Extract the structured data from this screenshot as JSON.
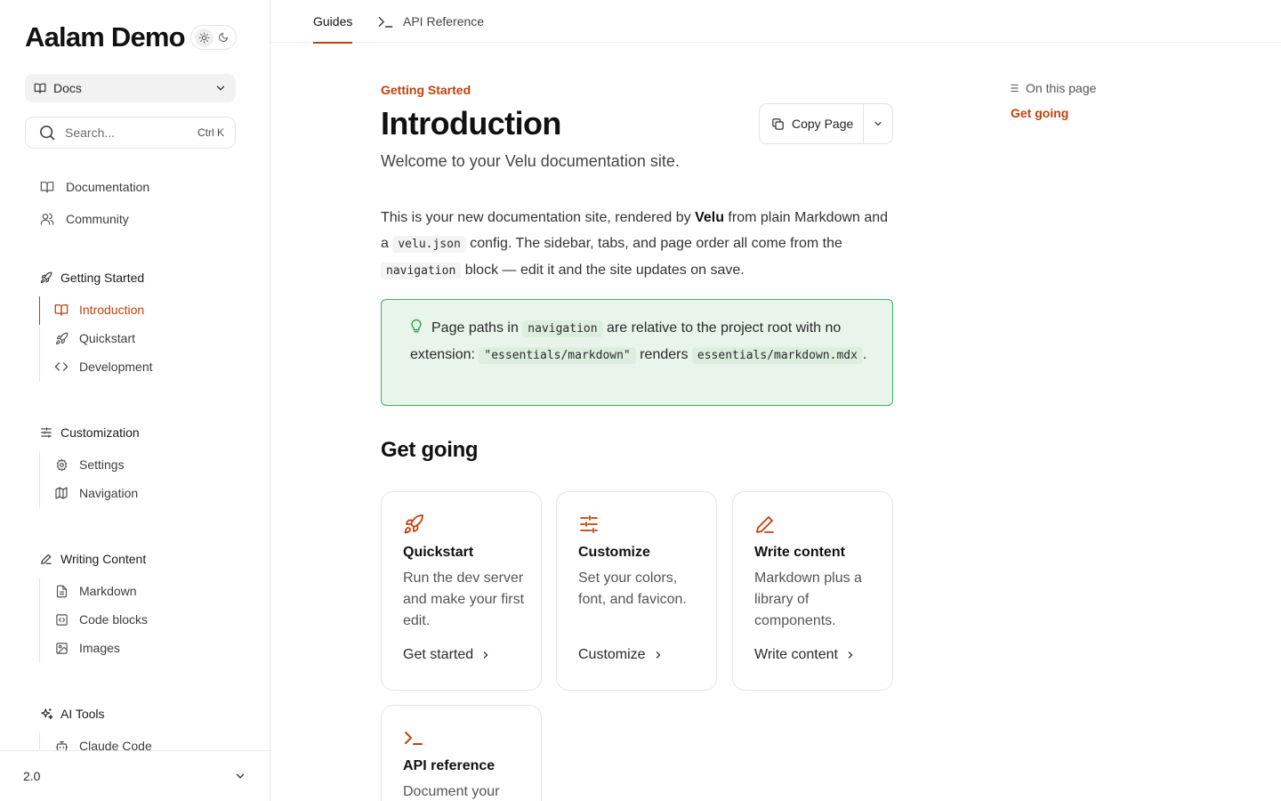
{
  "brand": {
    "title": "Aalam Demo"
  },
  "theme_toggle": {
    "light_icon": "sun-icon",
    "dark_icon": "moon-icon"
  },
  "docs_select": {
    "label": "Docs",
    "icon": "book-open-icon"
  },
  "search": {
    "placeholder": "Search...",
    "shortcut": "Ctrl K"
  },
  "sidebar": {
    "top_links": [
      {
        "label": "Documentation",
        "icon": "book-open-icon"
      },
      {
        "label": "Community",
        "icon": "users-icon"
      }
    ],
    "groups": [
      {
        "title": "Getting Started",
        "icon": "rocket-icon",
        "items": [
          {
            "label": "Introduction",
            "icon": "book-open-icon",
            "active": true
          },
          {
            "label": "Quickstart",
            "icon": "rocket-icon"
          },
          {
            "label": "Development",
            "icon": "code-icon"
          }
        ]
      },
      {
        "title": "Customization",
        "icon": "sliders-icon",
        "items": [
          {
            "label": "Settings",
            "icon": "gear-icon"
          },
          {
            "label": "Navigation",
            "icon": "map-icon"
          }
        ]
      },
      {
        "title": "Writing Content",
        "icon": "pencil-icon",
        "items": [
          {
            "label": "Markdown",
            "icon": "file-text-icon"
          },
          {
            "label": "Code blocks",
            "icon": "code-square-icon"
          },
          {
            "label": "Images",
            "icon": "image-icon"
          }
        ]
      },
      {
        "title": "AI Tools",
        "icon": "sparkles-icon",
        "items": [
          {
            "label": "Claude Code",
            "icon": "bot-icon"
          }
        ]
      }
    ],
    "version": "2.0"
  },
  "tabs": [
    {
      "label": "Guides",
      "active": true
    },
    {
      "label": "API Reference",
      "icon": "terminal-icon"
    }
  ],
  "page": {
    "eyebrow": "Getting Started",
    "title": "Introduction",
    "subtitle": "Welcome to your Velu documentation site.",
    "copy_button": "Copy Page",
    "intro": {
      "p1": "This is your new documentation site, rendered by ",
      "brand": "Velu",
      "p2": " from plain Markdown and a ",
      "code1": "velu.json",
      "p3": " config. The sidebar, tabs, and page order all come from the ",
      "code2": "navigation",
      "p4": " block — edit it and the site updates on save."
    },
    "tip": {
      "t1": "Page paths in ",
      "code1": "navigation",
      "t2": " are relative to the project root with no extension: ",
      "code2": "\"essentials/markdown\"",
      "t3": " renders ",
      "code3": "essentials/markdown.mdx",
      "t4": "."
    },
    "section_title": "Get going",
    "cards": [
      {
        "title": "Quickstart",
        "desc": "Run the dev server and make your first edit.",
        "link": "Get started",
        "icon": "rocket-icon"
      },
      {
        "title": "Customize",
        "desc": "Set your colors, font, and favicon.",
        "link": "Customize",
        "icon": "sliders-icon"
      },
      {
        "title": "Write content",
        "desc": "Markdown plus a library of components.",
        "link": "Write content",
        "icon": "pencil-icon"
      },
      {
        "title": "API reference",
        "desc": "Document your",
        "link": "",
        "icon": "terminal-icon"
      }
    ]
  },
  "toc": {
    "heading": "On this page",
    "links": [
      "Get going"
    ]
  },
  "colors": {
    "accent": "#c2410c",
    "tip_bg": "#e9f5ea",
    "tip_border": "#3cb15a"
  }
}
